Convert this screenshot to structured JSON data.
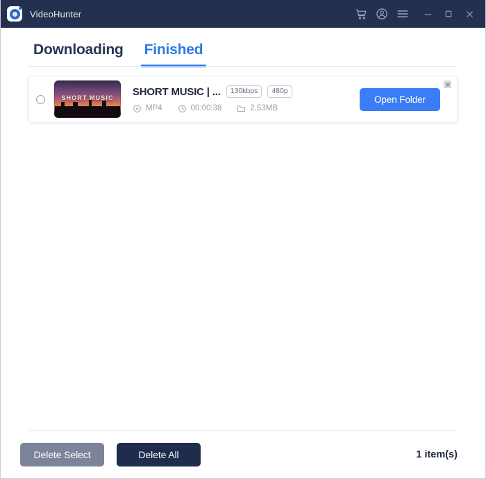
{
  "window": {
    "app_name": "VideoHunter",
    "logo_icon": "videohunter-logo-icon",
    "controls": {
      "cart_icon": "shopping-cart-icon",
      "account_icon": "account-circle-icon",
      "menu_icon": "hamburger-menu-icon",
      "minimize_icon": "minimize-icon",
      "maximize_icon": "maximize-icon",
      "close_icon": "close-icon"
    },
    "accent_color": "#3b7df4",
    "titlebar_color": "#23304f"
  },
  "tabs": [
    {
      "label": "Downloading",
      "active": false
    },
    {
      "label": "Finished",
      "active": true
    }
  ],
  "downloads": [
    {
      "selected": false,
      "title": "SHORT MUSIC | ...",
      "thumbnail_text": "SHORT MUSIC",
      "badges": [
        "130kbps",
        "480p"
      ],
      "format": "MP4",
      "format_icon": "play-circle-icon",
      "duration": "00:00:38",
      "duration_icon": "clock-icon",
      "filesize": "2.53MB",
      "filesize_icon": "folder-icon",
      "action_label": "Open Folder",
      "remove_icon": "close-icon"
    }
  ],
  "footer": {
    "delete_select_label": "Delete Select",
    "delete_all_label": "Delete All",
    "item_count": "1 item(s)"
  }
}
